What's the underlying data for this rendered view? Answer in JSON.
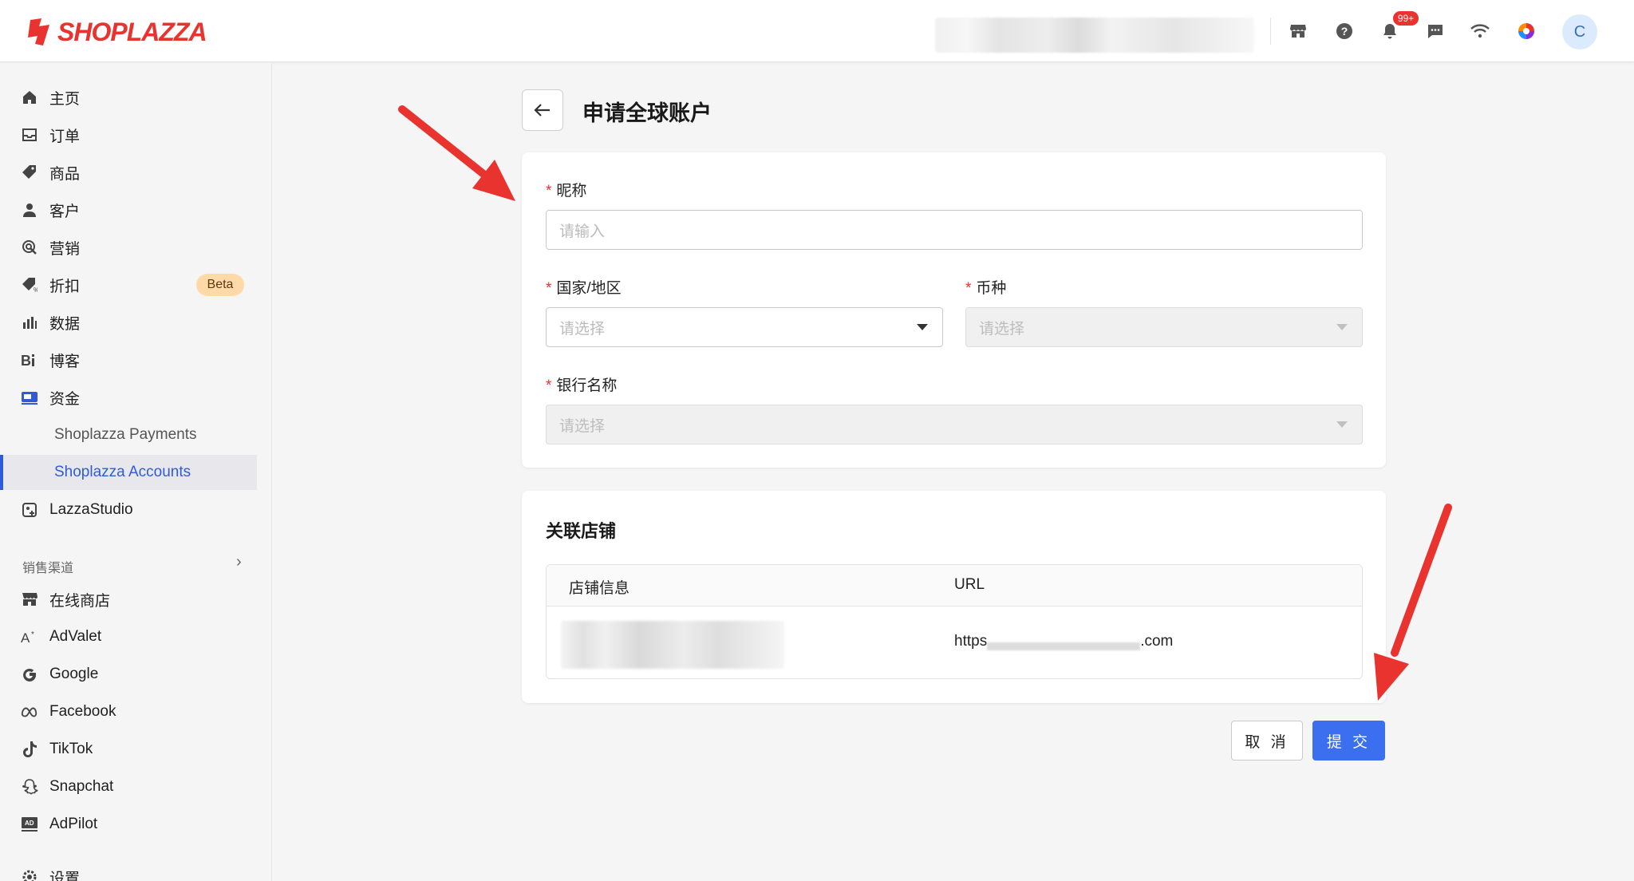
{
  "brand": {
    "name": "SHOPLAZZA"
  },
  "header": {
    "notification_badge": "99+",
    "avatar_initial": "C",
    "icons": [
      "store-icon",
      "help-icon",
      "bell-icon",
      "chat-icon",
      "wifi-icon",
      "color-wheel-icon"
    ]
  },
  "sidebar": {
    "items": [
      {
        "label": "主页",
        "icon": "home-icon"
      },
      {
        "label": "订单",
        "icon": "inbox-icon"
      },
      {
        "label": "商品",
        "icon": "tag-icon"
      },
      {
        "label": "客户",
        "icon": "person-icon"
      },
      {
        "label": "营销",
        "icon": "target-icon"
      },
      {
        "label": "折扣",
        "icon": "discount-icon",
        "badge": "Beta"
      },
      {
        "label": "数据",
        "icon": "bar-chart-icon"
      },
      {
        "label": "博客",
        "icon": "blog-icon"
      },
      {
        "label": "资金",
        "icon": "wallet-icon"
      }
    ],
    "sub_items": [
      {
        "label": "Shoplazza Payments"
      },
      {
        "label": "Shoplazza Accounts",
        "active": true
      }
    ],
    "lazzastudio": "LazzaStudio",
    "section_label": "销售渠道",
    "channels": [
      {
        "label": "在线商店",
        "icon": "store-icon"
      },
      {
        "label": "AdValet",
        "icon": "advalet-icon"
      },
      {
        "label": "Google",
        "icon": "google-icon"
      },
      {
        "label": "Facebook",
        "icon": "meta-icon"
      },
      {
        "label": "TikTok",
        "icon": "tiktok-icon"
      },
      {
        "label": "Snapchat",
        "icon": "snapchat-icon"
      },
      {
        "label": "AdPilot",
        "icon": "adpilot-icon"
      }
    ],
    "settings": "设置"
  },
  "page": {
    "title": "申请全球账户"
  },
  "form": {
    "nickname": {
      "label": "昵称",
      "placeholder": "请输入"
    },
    "country": {
      "label": "国家/地区",
      "placeholder": "请选择"
    },
    "currency": {
      "label": "币种",
      "placeholder": "请选择"
    },
    "bank": {
      "label": "银行名称",
      "placeholder": "请选择"
    }
  },
  "linked_store": {
    "title": "关联店铺",
    "columns": [
      "店铺信息",
      "URL"
    ],
    "url_prefix": "https",
    "url_suffix": ".com"
  },
  "actions": {
    "cancel": "取 消",
    "submit": "提 交"
  },
  "colors": {
    "accent": "#3b6ff0",
    "brand": "#e8332f",
    "active_nav": "#2f5bdb"
  }
}
